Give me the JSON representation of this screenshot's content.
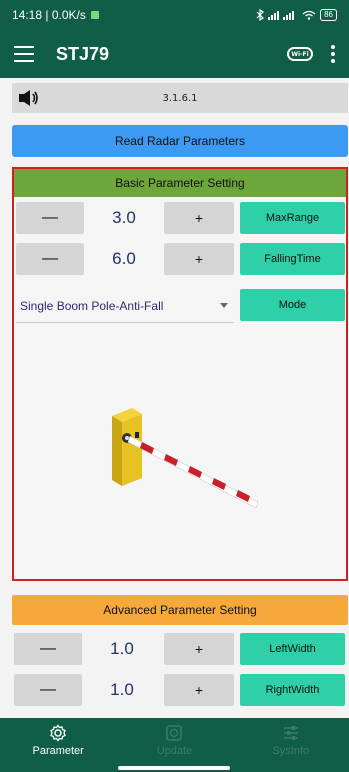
{
  "status_bar": {
    "time_speed": "14:18 | 0.0K/s",
    "battery": "86"
  },
  "app_bar": {
    "title": "STJ79",
    "wifi_label": "Wi-Fi"
  },
  "version_bar": {
    "version": "3.1.6.1"
  },
  "read_button": {
    "label": "Read Radar Parameters"
  },
  "basic_panel": {
    "header": "Basic Parameter Setting",
    "rows": [
      {
        "minus": "—",
        "value": "3.0",
        "plus": "+",
        "action": "MaxRange"
      },
      {
        "minus": "—",
        "value": "6.0",
        "plus": "+",
        "action": "FallingTime"
      }
    ],
    "mode_select": {
      "value": "Single Boom Pole-Anti-Fall",
      "action": "Mode"
    }
  },
  "advanced_panel": {
    "header": "Advanced Parameter Setting",
    "rows": [
      {
        "minus": "—",
        "value": "1.0",
        "plus": "+",
        "action": "LeftWidth"
      },
      {
        "minus": "—",
        "value": "1.0",
        "plus": "+",
        "action": "RightWidth"
      }
    ]
  },
  "bottom_nav": {
    "items": [
      {
        "label": "Parameter",
        "icon": "gear-icon",
        "active": true
      },
      {
        "label": "Update",
        "icon": "update-icon",
        "active": false
      },
      {
        "label": "SysInfo",
        "icon": "sliders-icon",
        "active": false
      }
    ]
  },
  "colors": {
    "primary": "#0f5e45",
    "read_button": "#3d9af2",
    "basic_header": "#6da63a",
    "advanced_header": "#f4a93a",
    "action_button": "#2fcfa8",
    "panel_border": "#d02020"
  }
}
